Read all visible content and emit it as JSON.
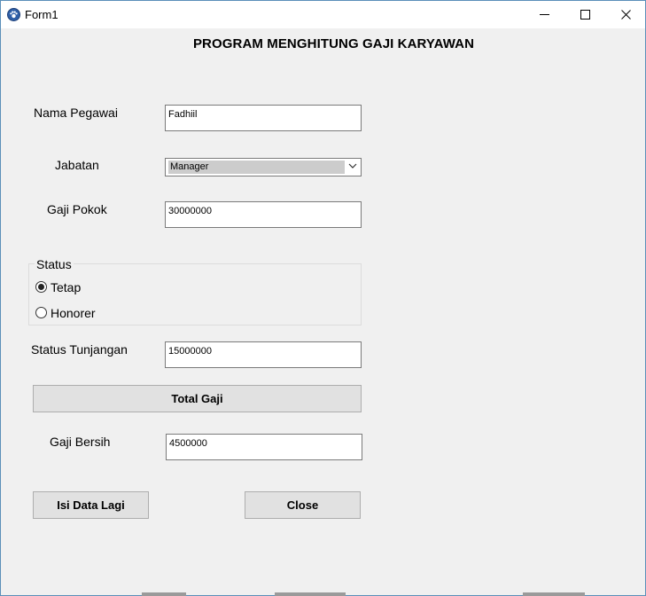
{
  "window": {
    "title": "Form1",
    "controls": {
      "minimize_icon": "minimize-icon",
      "maximize_icon": "maximize-icon",
      "close_icon": "close-icon"
    }
  },
  "form": {
    "heading": "PROGRAM MENGHITUNG GAJI KARYAWAN",
    "nama_pegawai": {
      "label": "Nama Pegawai",
      "value": "Fadhiil"
    },
    "jabatan": {
      "label": "Jabatan",
      "selected": "Manager"
    },
    "gaji_pokok": {
      "label": "Gaji Pokok",
      "value": "30000000"
    },
    "status": {
      "title": "Status",
      "options": [
        {
          "label": "Tetap",
          "checked": true
        },
        {
          "label": "Honorer",
          "checked": false
        }
      ]
    },
    "status_tunjangan": {
      "label": "Status Tunjangan",
      "value": "15000000"
    },
    "total_button": "Total Gaji",
    "gaji_bersih": {
      "label": "Gaji Bersih",
      "value": "4500000"
    },
    "isi_data_button": "Isi Data Lagi",
    "close_button": "Close"
  },
  "colors": {
    "window_bg": "#f0f0f0",
    "titlebar_bg": "#ffffff",
    "button_bg": "#e1e1e1",
    "border": "#7a7a7a"
  }
}
